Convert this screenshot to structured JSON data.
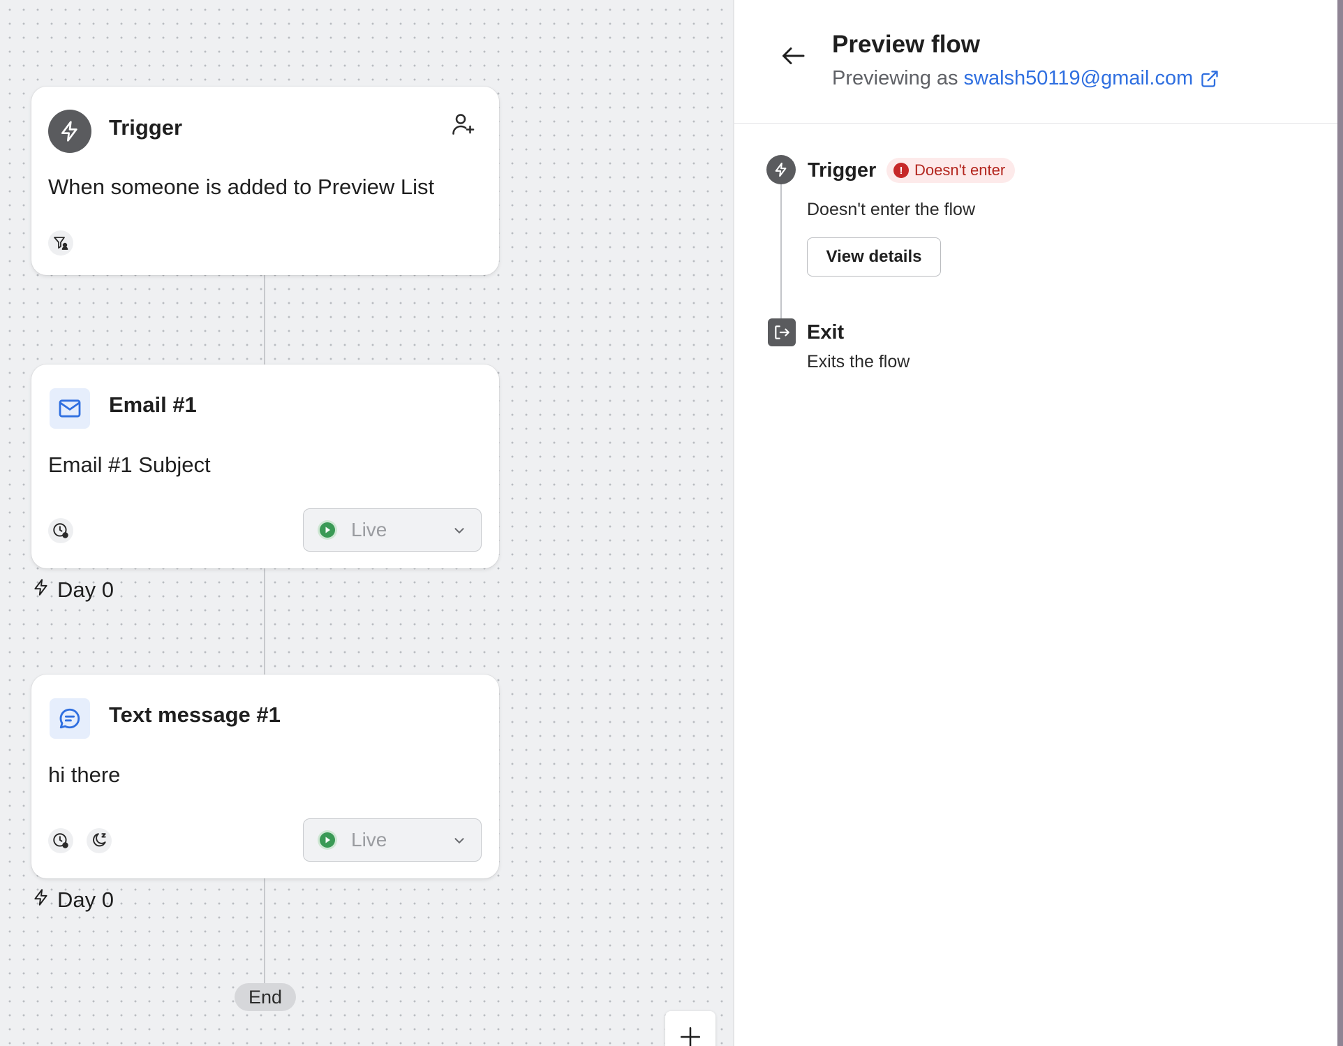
{
  "canvas": {
    "trigger_card": {
      "title": "Trigger",
      "description": "When someone is added to Preview List",
      "icons": [
        "bolt-icon",
        "person-add-icon",
        "filter-person-icon"
      ]
    },
    "email_card": {
      "title": "Email #1",
      "subject": "Email #1 Subject",
      "status": "Live",
      "day_label": "Day 0",
      "icons": [
        "mail-icon",
        "clock-settings-icon",
        "play-icon",
        "chevron-down-icon"
      ]
    },
    "sms_card": {
      "title": "Text message #1",
      "body": "hi there",
      "status": "Live",
      "day_label": "Day 0",
      "icons": [
        "chat-icon",
        "clock-settings-icon",
        "quiet-hours-moon-icon",
        "play-icon",
        "chevron-down-icon"
      ]
    },
    "end_label": "End",
    "add_button_icon": "plus-icon"
  },
  "panel": {
    "title": "Preview flow",
    "previewing_prefix": "Previewing as",
    "previewing_email": "swalsh50119@gmail.com",
    "timeline": [
      {
        "title": "Trigger",
        "badge": "Doesn't enter",
        "description": "Doesn't enter the flow",
        "button": "View details",
        "icon": "bolt-icon"
      },
      {
        "title": "Exit",
        "description": "Exits the flow",
        "icon": "exit-icon"
      }
    ]
  },
  "colors": {
    "link": "#2f6fe0",
    "error": "#c62828",
    "live_green": "#3a9a55",
    "icon_dark": "#5a5b5e"
  }
}
